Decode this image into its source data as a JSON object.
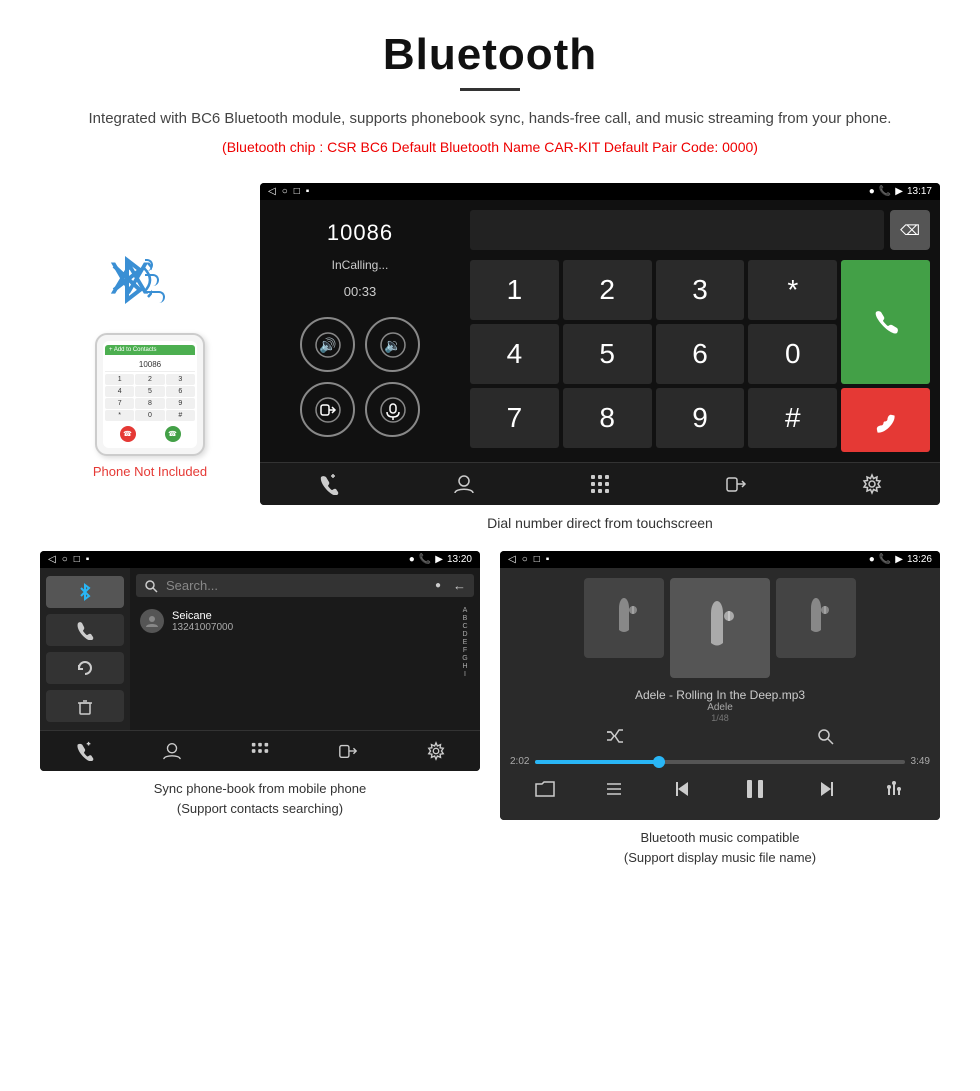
{
  "page": {
    "title": "Bluetooth",
    "description": "Integrated with BC6 Bluetooth module, supports phonebook sync, hands-free call, and music streaming from your phone.",
    "specs": "(Bluetooth chip : CSR BC6    Default Bluetooth Name CAR-KIT    Default Pair Code: 0000)",
    "phone_not_included": "Phone Not Included",
    "main_caption": "Dial number direct from touchscreen",
    "bottom_left_caption_line1": "Sync phone-book from mobile phone",
    "bottom_left_caption_line2": "(Support contacts searching)",
    "bottom_right_caption_line1": "Bluetooth music compatible",
    "bottom_right_caption_line2": "(Support display music file name)"
  },
  "dialer": {
    "number": "10086",
    "status": "InCalling...",
    "time": "00:33"
  },
  "status_bar": {
    "time_main": "13:17",
    "time_left": "13:20",
    "time_right": "13:26"
  },
  "phonebook": {
    "contact_name": "Seicane",
    "contact_number": "13241007000"
  },
  "music": {
    "track": "Adele - Rolling In the Deep.mp3",
    "artist": "Adele",
    "count": "1/48",
    "time_current": "2:02",
    "time_total": "3:49"
  },
  "keys": {
    "row1": [
      "1",
      "2",
      "3",
      "*"
    ],
    "row2": [
      "4",
      "5",
      "6",
      "0"
    ],
    "row3": [
      "7",
      "8",
      "9",
      "#"
    ],
    "call_icon": "📞",
    "end_icon": "📞"
  }
}
